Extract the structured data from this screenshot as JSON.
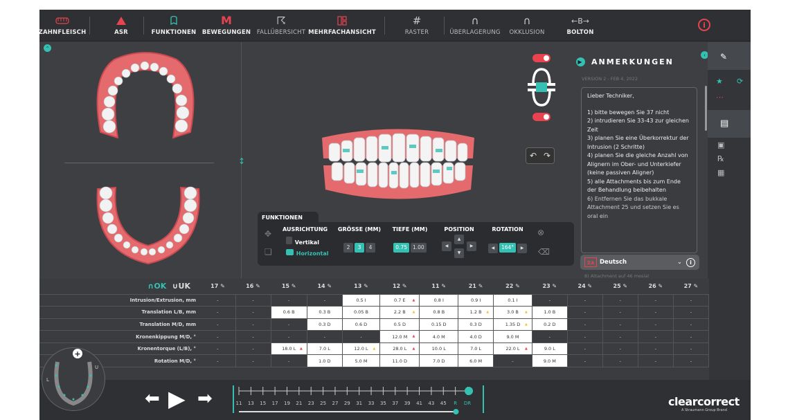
{
  "toolbar": {
    "items": [
      {
        "label": "ZAHNFLEISCH",
        "icon": "gum-icon"
      },
      {
        "label": "ASR",
        "icon": "triangle-icon"
      },
      {
        "label": "FUNKTIONEN",
        "icon": "tooth-outline-icon"
      },
      {
        "label": "BEWEGUNGEN",
        "icon": "letter-m-icon"
      },
      {
        "label": "FALLÜBERSICHT",
        "icon": "case-overview-icon"
      },
      {
        "label": "MEHRFACHANSICHT",
        "icon": "multi-view-icon"
      },
      {
        "label": "RASTER",
        "icon": "grid-icon"
      },
      {
        "label": "ÜBERLAGERUNG",
        "icon": "overlay-icon"
      },
      {
        "label": "OKKLUSION",
        "icon": "occlusion-icon"
      },
      {
        "label": "BOLTON",
        "icon": "bolton-icon"
      }
    ],
    "info_icon": "i"
  },
  "features_panel": {
    "tab": "FUNKTIONEN",
    "ausrichtung": {
      "header": "AUSRICHTUNG",
      "options": [
        "Vertikal",
        "Horizontal"
      ],
      "selected": "Horizontal"
    },
    "groesse": {
      "header": "GRÖSSE (MM)",
      "options": [
        "2",
        "3",
        "4"
      ],
      "selected": "3"
    },
    "tiefe": {
      "header": "TIEFE (MM)",
      "options": [
        "0.75",
        "1.00"
      ],
      "selected": "0.75"
    },
    "position": {
      "header": "POSITION"
    },
    "rotation": {
      "header": "ROTATION",
      "value": "164°"
    }
  },
  "notes": {
    "title": "ANMERKUNGEN",
    "version": "VERSION 2 - FEB 4, 2022",
    "text_lines": [
      "Lieber Techniker,",
      "",
      "1) bitte bewegen Sie 37 nicht",
      "2) intrudieren Sie 33-43 zur gleichen Zeit",
      "3) planen Sie eine Überkorrektur der Intrusion (2 Schritte)",
      "4) planen Sie die gleiche Anzahl von Alignern im Ober- und Unterkiefer (keine passiven Aligner)",
      "5) alle Attachments bis zum Ende der Behandlung beibehalten",
      "6) Entfernen Sie das bukkale Attachment 25 und setzen Sie es oral ein"
    ],
    "language": "Deutsch",
    "more_text": "8) Attachment auf 46 mesial"
  },
  "table": {
    "ok_label": "OK",
    "uk_label": "UK",
    "teeth": [
      "17",
      "16",
      "15",
      "14",
      "13",
      "12",
      "11",
      "21",
      "22",
      "23",
      "24",
      "25",
      "26",
      "27"
    ],
    "rows": [
      {
        "label": "Intrusion/Extrusion, mm",
        "cells": [
          "-",
          "-",
          "-",
          "-",
          "0.5 I",
          "0.7 E",
          "0.8 I",
          "0.9 I",
          "0.1 I",
          "-",
          "-",
          "-",
          "-",
          "-"
        ]
      },
      {
        "label": "Translation L/B, mm",
        "cells": [
          "-",
          "-",
          "0.6 B",
          "0.3 B",
          "0.05 B",
          "2.2 B",
          "0.8 B",
          "1.2 B",
          "3.0 B",
          "1.0 B",
          "-",
          "-",
          "-",
          "-"
        ]
      },
      {
        "label": "Translation M/D, mm",
        "cells": [
          "-",
          "-",
          "-",
          "0.3 D",
          "0.6 D",
          "0.5 D",
          "0.15 D",
          "0.3 D",
          "1.35 D",
          "0.2 D",
          "-",
          "-",
          "-",
          "-"
        ]
      },
      {
        "label": "Kronenkippung M/D, °",
        "cells": [
          "-",
          "-",
          "-",
          "-",
          "-",
          "12.0 M",
          "4.0 M",
          "4.0 D",
          "9.0 M",
          "-",
          "-",
          "-",
          "-",
          "-"
        ]
      },
      {
        "label": "Kronentorque (L/B), °",
        "cells": [
          "-",
          "-",
          "18.0 L",
          "7.0 L",
          "12.0 L",
          "28.0 L",
          "10.0 L",
          "7.0 L",
          "22.0 L",
          "9.0 L",
          "-",
          "-",
          "-",
          "-"
        ]
      },
      {
        "label": "Rotation M/D, °",
        "cells": [
          "-",
          "-",
          "-",
          "1.0 D",
          "5.0 M",
          "11.0 D",
          "7.0 D",
          "6.0 M",
          "-",
          "9.0 M",
          "-",
          "-",
          "-",
          "-"
        ]
      }
    ]
  },
  "timeline": {
    "labels": [
      "11",
      "13",
      "15",
      "17",
      "19",
      "21",
      "23",
      "25",
      "27",
      "29",
      "31",
      "33",
      "35",
      "37",
      "39",
      "41",
      "43",
      "45",
      "R",
      "DR"
    ],
    "progress": 0.95
  },
  "minimap": {
    "u_label": "U",
    "l_label": "L"
  },
  "logo": {
    "name": "clearcorrect",
    "sub": "A Straumann Group Brand"
  }
}
